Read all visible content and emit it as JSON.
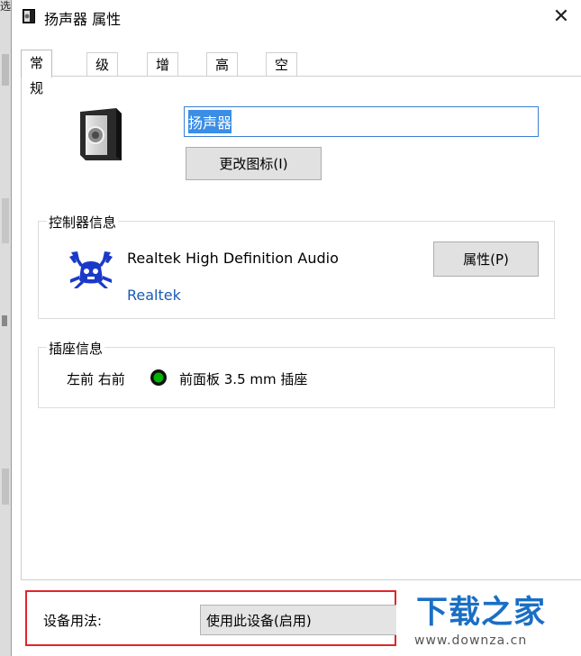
{
  "left_strip": {
    "label": "选"
  },
  "window": {
    "title": "扬声器 属性",
    "close_glyph": "✕"
  },
  "tabs": [
    {
      "label": "常规",
      "active": true
    },
    {
      "label": "级别",
      "active": false
    },
    {
      "label": "增强",
      "active": false
    },
    {
      "label": "高级",
      "active": false
    },
    {
      "label": "空间音效",
      "active": false
    }
  ],
  "general": {
    "device_name": "扬声器",
    "change_icon_label": "更改图标(I)",
    "controller": {
      "group_title": "控制器信息",
      "name": "Realtek High Definition Audio",
      "vendor": "Realtek",
      "properties_label": "属性(P)"
    },
    "jack": {
      "group_title": "插座信息",
      "position": "左前 右前",
      "description": "前面板 3.5 mm 插座",
      "dot_color": "#00b400"
    },
    "usage": {
      "label": "设备用法:",
      "selected": "使用此设备(启用)"
    }
  },
  "watermark": {
    "title": "下载之家",
    "url": "www.downza.cn"
  },
  "colors": {
    "accent": "#3b8ee6",
    "highlight_border": "#e0262b",
    "link": "#1a5bb5",
    "watermark": "#1a6fc4"
  }
}
